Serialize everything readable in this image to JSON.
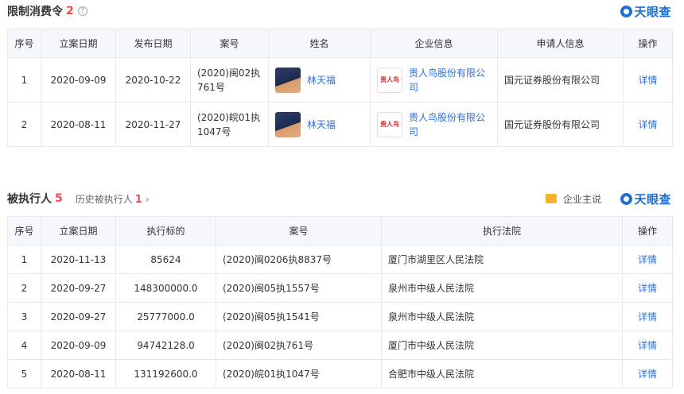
{
  "restriction": {
    "title": "限制消费令",
    "count": "2",
    "help_glyph": "?",
    "logo": "天眼查",
    "headers": [
      "序号",
      "立案日期",
      "发布日期",
      "案号",
      "姓名",
      "企业信息",
      "申请人信息",
      "操作"
    ],
    "rows": [
      {
        "no": "1",
        "filed": "2020-09-09",
        "published": "2020-10-22",
        "case": "(2020)闽02执761号",
        "name": "林天福",
        "company": "贵人鸟股份有限公司",
        "company_logo": "贵人鸟",
        "applicant": "国元证券股份有限公司",
        "action": "详情"
      },
      {
        "no": "2",
        "filed": "2020-08-11",
        "published": "2020-11-27",
        "case": "(2020)皖01执1047号",
        "name": "林天福",
        "company": "贵人鸟股份有限公司",
        "company_logo": "贵人鸟",
        "applicant": "国元证券股份有限公司",
        "action": "详情"
      }
    ]
  },
  "executed": {
    "title": "被执行人",
    "count": "5",
    "history_label": "历史被执行人",
    "history_count": "1",
    "history_arrow": "›",
    "business_owner": "企业主说",
    "logo": "天眼查",
    "headers": [
      "序号",
      "立案日期",
      "执行标的",
      "案号",
      "执行法院",
      "操作"
    ],
    "rows": [
      {
        "no": "1",
        "filed": "2020-11-13",
        "amount": "85624",
        "case": "(2020)闽0206执8837号",
        "court": "厦门市湖里区人民法院",
        "action": "详情"
      },
      {
        "no": "2",
        "filed": "2020-09-27",
        "amount": "148300000.0",
        "case": "(2020)闽05执1557号",
        "court": "泉州市中级人民法院",
        "action": "详情"
      },
      {
        "no": "3",
        "filed": "2020-09-27",
        "amount": "25777000.0",
        "case": "(2020)闽05执1541号",
        "court": "泉州市中级人民法院",
        "action": "详情"
      },
      {
        "no": "4",
        "filed": "2020-09-09",
        "amount": "94742128.0",
        "case": "(2020)闽02执761号",
        "court": "厦门市中级人民法院",
        "action": "详情"
      },
      {
        "no": "5",
        "filed": "2020-08-11",
        "amount": "131192600.0",
        "case": "(2020)皖01执1047号",
        "court": "合肥市中级人民法院",
        "action": "详情"
      }
    ]
  }
}
